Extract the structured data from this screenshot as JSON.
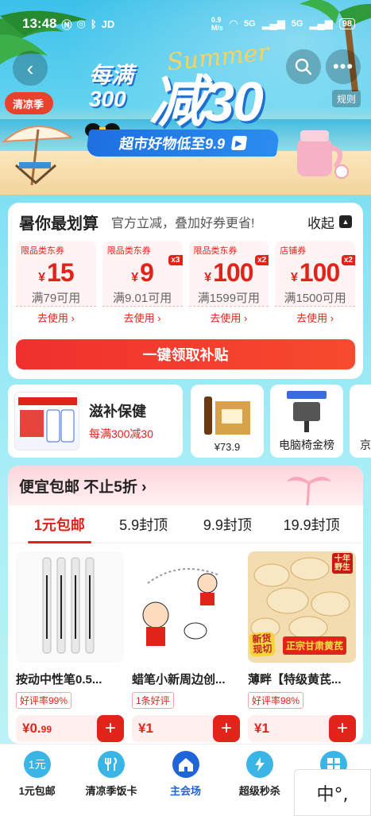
{
  "status_bar": {
    "time": "13:48",
    "net_speed": "0.9\nM/s",
    "signal1": "5G",
    "signal2": "5G",
    "battery": "98"
  },
  "header": {
    "season_tag": "清凉季",
    "rules": "规则",
    "summer_word": "Summer",
    "title_small_1": "每满",
    "title_small_2": "300",
    "title_big": "减30",
    "subtitle": "超市好物低至9.9"
  },
  "savings": {
    "title": "暑你最划算",
    "subtitle": "官方立减，叠加好券更省!",
    "collapse": "收起",
    "coupons": [
      {
        "type": "限品类东券",
        "yen": "¥",
        "amount": "15",
        "mult": "",
        "cond": "满79可用",
        "use": "去使用 ›"
      },
      {
        "type": "限品类东券",
        "yen": "¥",
        "amount": "9",
        "mult": "x3",
        "cond": "满9.01可用",
        "use": "去使用 ›"
      },
      {
        "type": "限品类东券",
        "yen": "¥",
        "amount": "100",
        "mult": "x2",
        "cond": "满1599可用",
        "use": "去使用 ›"
      },
      {
        "type": "店铺券",
        "yen": "¥",
        "amount": "100",
        "mult": "x2",
        "cond": "满1500可用",
        "use": "去使用 ›"
      }
    ],
    "claim_button": "一键领取补贴"
  },
  "categories": {
    "main": {
      "title": "滋补保健",
      "subtitle": "每满300减30"
    },
    "cards": [
      {
        "label": "",
        "price": "¥73.9"
      },
      {
        "label": "电脑椅金榜",
        "price": ""
      },
      {
        "label": "京",
        "price": ""
      }
    ]
  },
  "shipping": {
    "title": "便宜包邮 不止5折 ›",
    "tabs": [
      "1元包邮",
      "5.9封顶",
      "9.9封顶",
      "19.9封顶"
    ],
    "products": [
      {
        "name": "按动中性笔0.5...",
        "tag": "好评率99%",
        "price_main": "¥0.",
        "price_sub": "99"
      },
      {
        "name": "蜡笔小新周边创...",
        "tag": "1条好评",
        "price_main": "¥1",
        "price_sub": ""
      },
      {
        "name": "薄畔【特级黄芪...",
        "tag": "好评率98%",
        "price_main": "¥1",
        "price_sub": "",
        "badge_new": "新货\n现切",
        "badge_title": "正宗甘肃黄芪",
        "badge_years": "十年\n野生"
      }
    ]
  },
  "bottom_nav": {
    "items": [
      {
        "label": "1元包邮",
        "icon": "one-yuan-icon",
        "color": "#3ab5e6"
      },
      {
        "label": "清凉季饭卡",
        "icon": "fork-spoon-icon",
        "color": "#3ab5e6"
      },
      {
        "label": "主会场",
        "icon": "home-icon",
        "color": "#1f64d8"
      },
      {
        "label": "超级秒杀",
        "icon": "lightning-icon",
        "color": "#3ab5e6"
      },
      {
        "label": "",
        "icon": "grid-icon",
        "color": "#3ab5e6"
      }
    ]
  },
  "ime": {
    "text": "中°,"
  },
  "colors": {
    "accent": "#e2231a",
    "nav_active": "#1f64d8",
    "sky": "#5ad0ee"
  }
}
